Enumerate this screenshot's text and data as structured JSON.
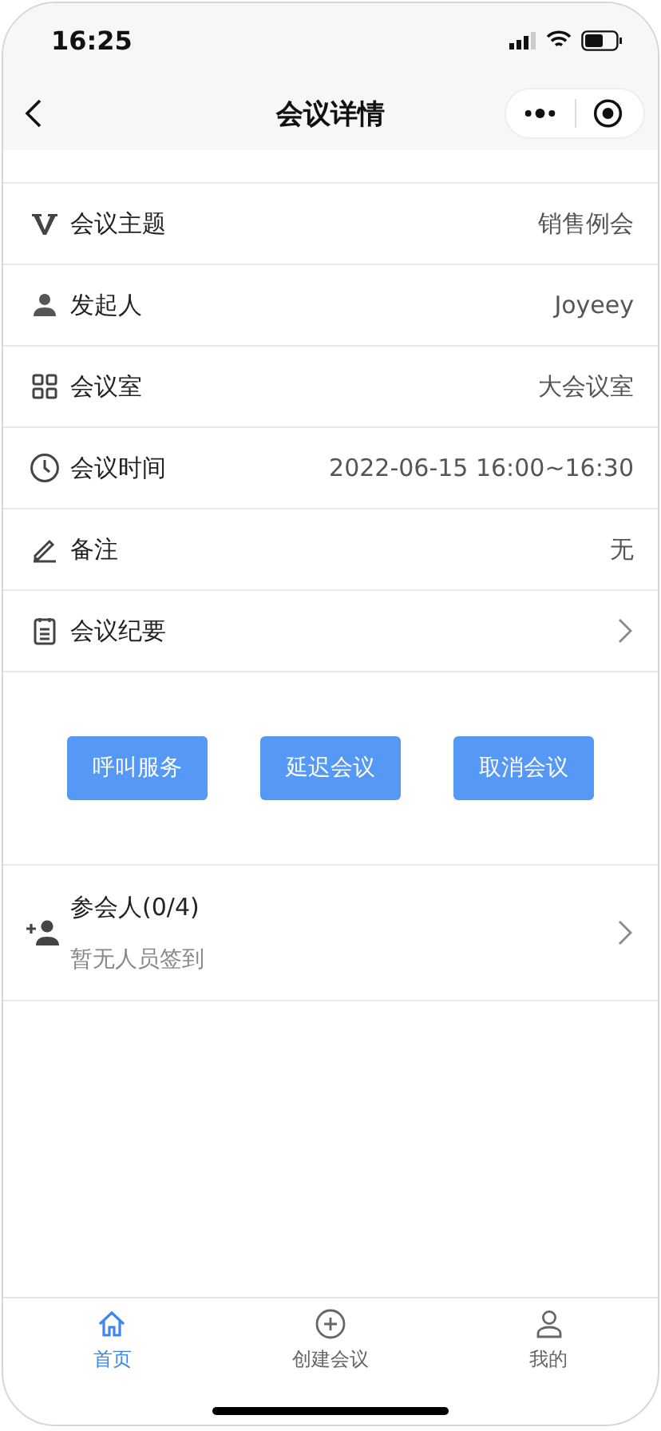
{
  "status_bar": {
    "time": "16:25"
  },
  "nav": {
    "title": "会议详情"
  },
  "rows": [
    {
      "kind": "value",
      "label": "会议主题",
      "value": "销售例会"
    },
    {
      "kind": "value",
      "label": "发起人",
      "value": "Joyeey"
    },
    {
      "kind": "value",
      "label": "会议室",
      "value": "大会议室"
    },
    {
      "kind": "value",
      "label": "会议时间",
      "value": "2022-06-15 16:00~16:30"
    },
    {
      "kind": "value",
      "label": "备注",
      "value": "无"
    },
    {
      "kind": "link",
      "label": "会议纪要"
    }
  ],
  "actions": [
    "呼叫服务",
    "延迟会议",
    "取消会议"
  ],
  "attendees": {
    "title": "参会人(0/4)",
    "note": "暂无人员签到"
  },
  "tabs": [
    {
      "label": "首页",
      "selected": true
    },
    {
      "label": "创建会议",
      "selected": false
    },
    {
      "label": "我的",
      "selected": false
    }
  ]
}
